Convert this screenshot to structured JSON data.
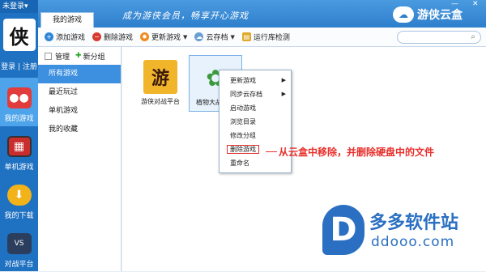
{
  "window": {
    "status": "未登录",
    "status_arrow": "▾",
    "minimize": "—",
    "close": "✕"
  },
  "header": {
    "tab_label": "我的游戏",
    "slogan": "成为游侠会员，畅享开心游戏",
    "brand": "游侠云盒",
    "logo_char": "侠"
  },
  "toolbar": {
    "items": [
      {
        "label": "添加游戏",
        "icon": "add-icon",
        "color": "#2f86d6"
      },
      {
        "label": "删除游戏",
        "icon": "delete-icon",
        "color": "#d93a2f"
      },
      {
        "label": "更新游戏",
        "icon": "update-icon",
        "color": "#f08a1c"
      },
      {
        "label": "云存档",
        "icon": "cloud-icon",
        "color": "#6a9fd4"
      },
      {
        "label": "运行库检测",
        "icon": "library-icon",
        "color": "#e0a92a"
      }
    ],
    "dropdown_glyph": "▼",
    "search_glyph": "⌕"
  },
  "sidebar": {
    "login": "登录",
    "register": "注册",
    "separator": "|",
    "items": [
      {
        "label": "我的游戏",
        "icon": "gamepad-icon",
        "active": true
      },
      {
        "label": "单机游戏",
        "icon": "arcade-icon",
        "active": false
      },
      {
        "label": "我的下载",
        "icon": "download-icon",
        "active": false
      },
      {
        "label": "对战平台",
        "icon": "battle-platform-icon",
        "active": false
      }
    ]
  },
  "categories": {
    "manage_label": "管理",
    "new_group_label": "新分组",
    "plus_glyph": "✚",
    "items": [
      {
        "label": "所有游戏",
        "active": true
      },
      {
        "label": "最近玩过",
        "active": false
      },
      {
        "label": "单机游戏",
        "active": false
      },
      {
        "label": "我的收藏",
        "active": false
      }
    ]
  },
  "games": [
    {
      "name": "游侠对战平台",
      "icon_char": "游",
      "selected": false
    },
    {
      "name": "植物大战僵尸",
      "icon_char": "✿",
      "selected": true
    }
  ],
  "context_menu": {
    "items": [
      {
        "label": "更新游戏",
        "submenu": true,
        "highlight": false
      },
      {
        "label": "同步云存档",
        "submenu": true,
        "highlight": false
      },
      {
        "label": "启动游戏",
        "submenu": false,
        "highlight": false
      },
      {
        "label": "浏览目录",
        "submenu": false,
        "highlight": false
      },
      {
        "label": "修改分组",
        "submenu": false,
        "highlight": false
      },
      {
        "label": "删除游戏",
        "submenu": false,
        "highlight": true
      },
      {
        "label": "重命名",
        "submenu": false,
        "highlight": false
      }
    ],
    "submenu_glyph": "▶"
  },
  "annotation": "从云盒中移除，并删除硬盘中的文件",
  "watermark": {
    "logo_letter": "D",
    "line1": "多多软件站",
    "line2": "ddooo.com"
  }
}
